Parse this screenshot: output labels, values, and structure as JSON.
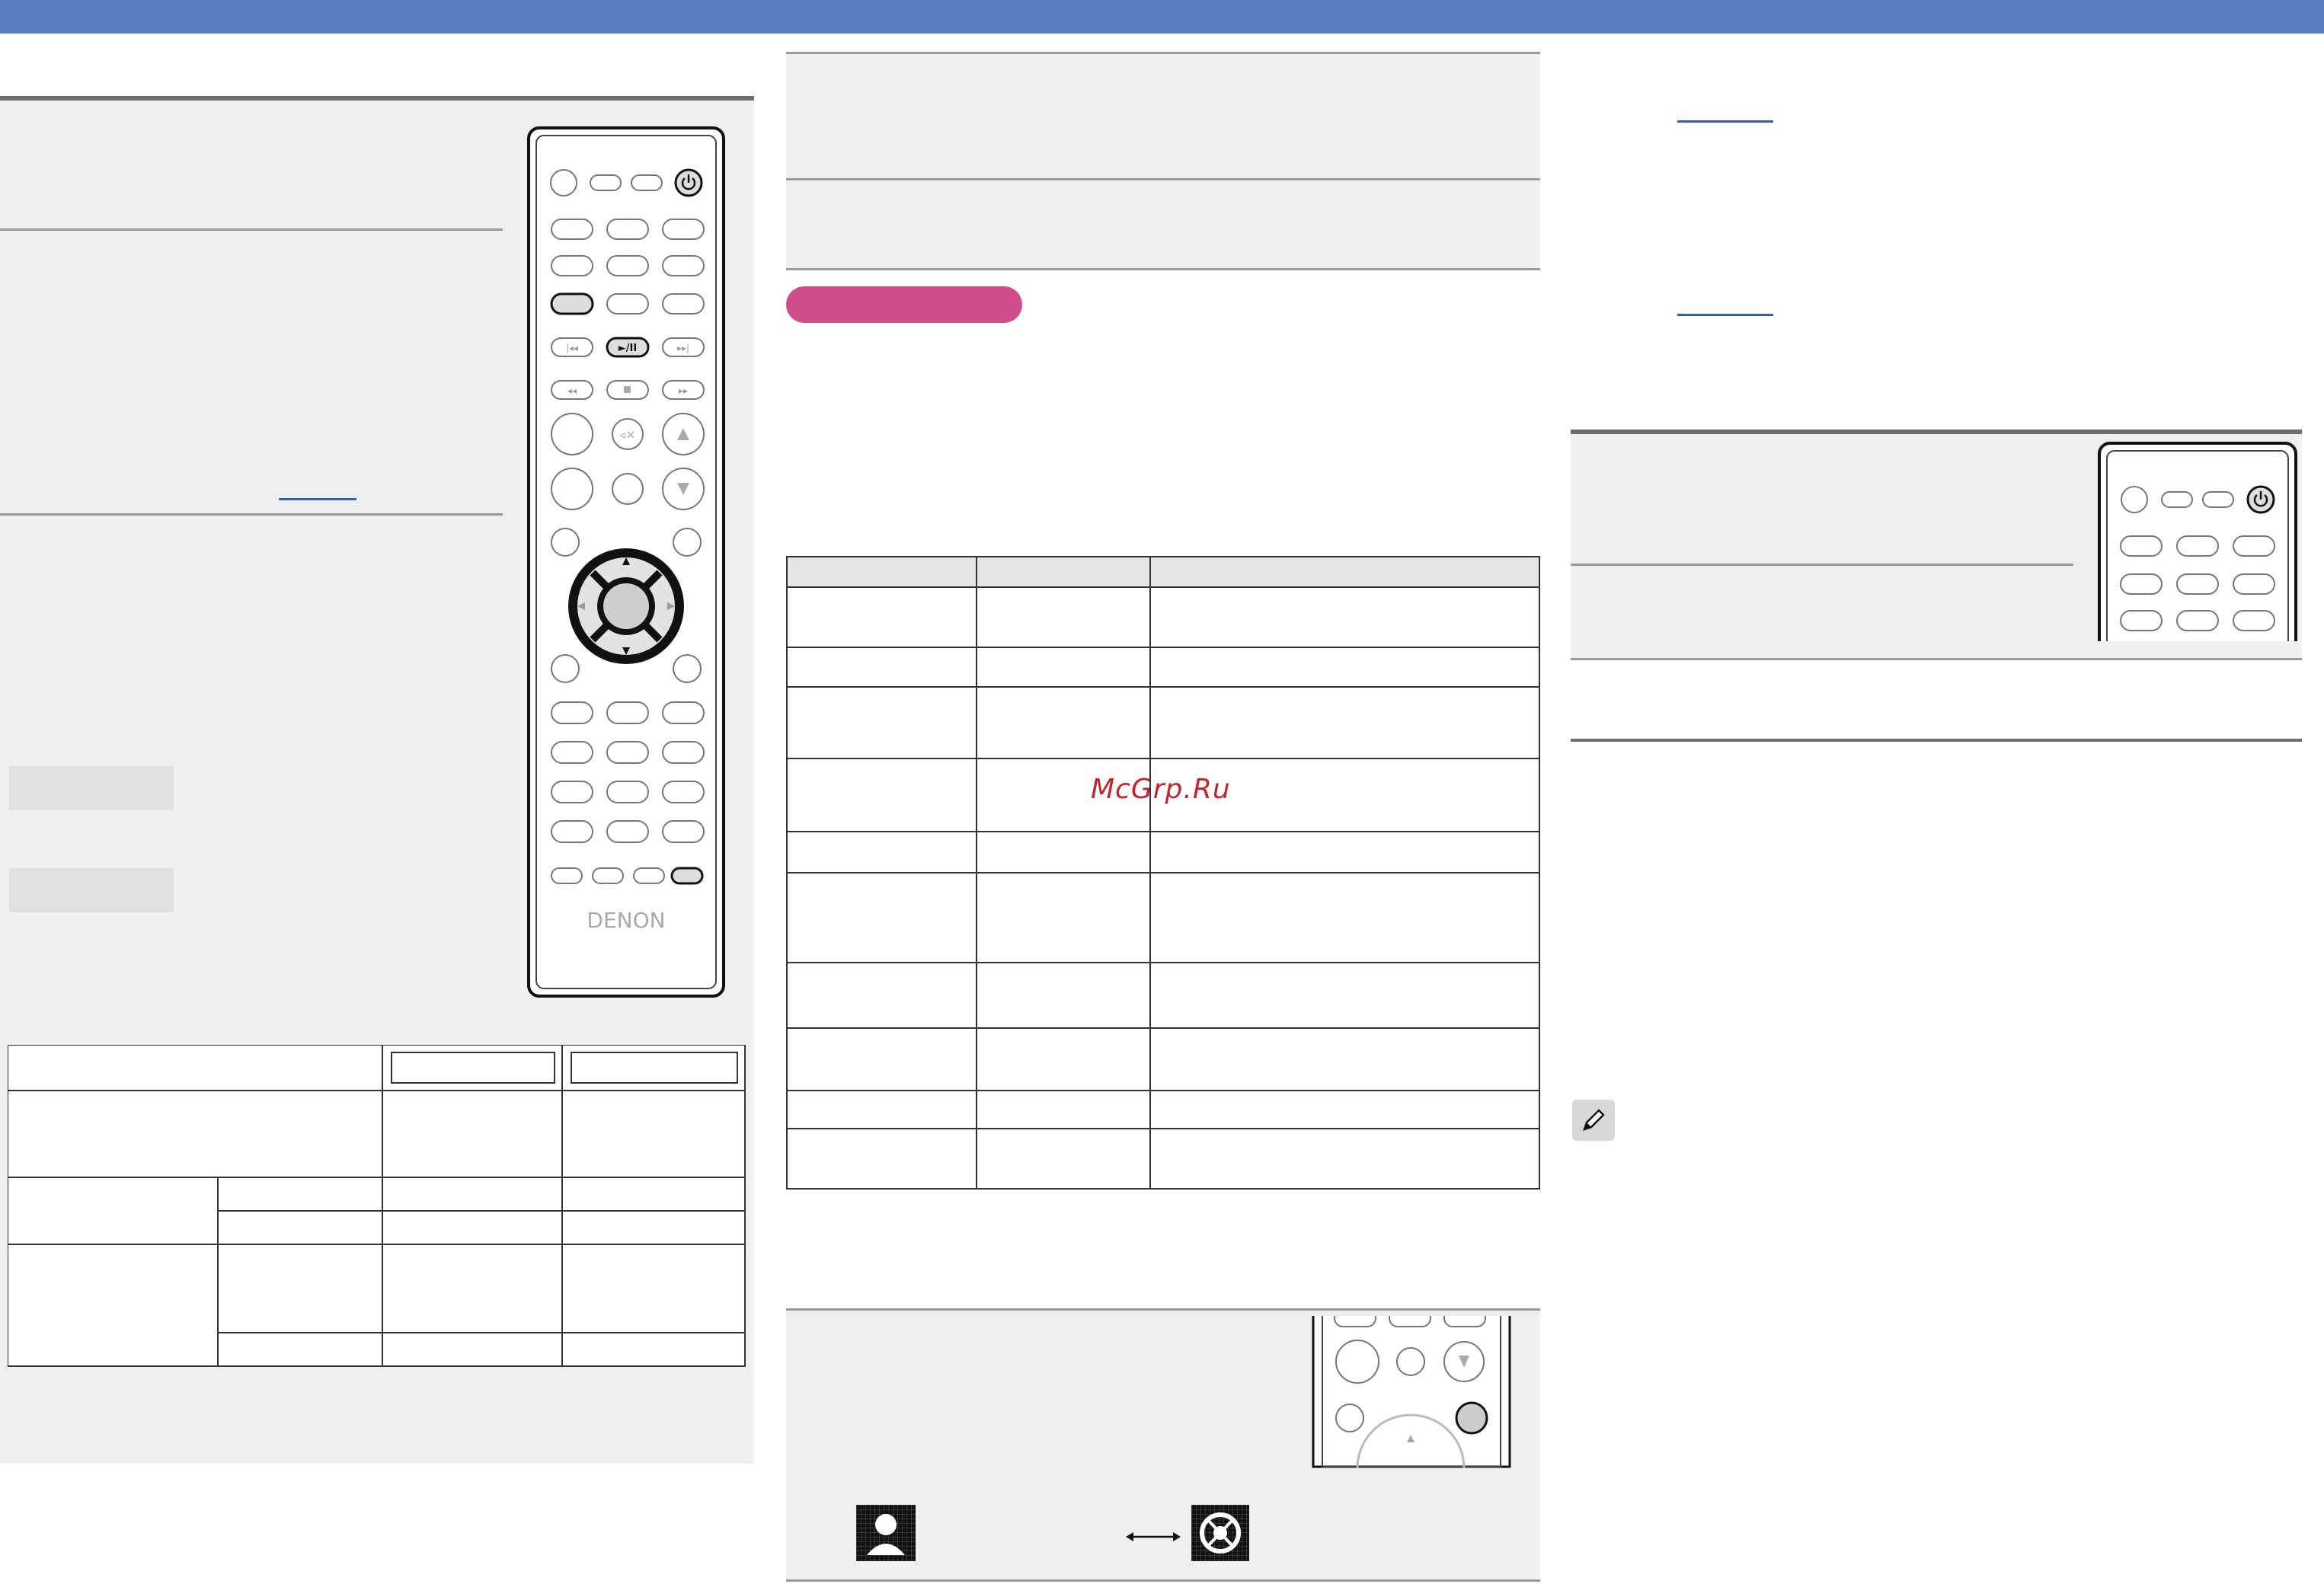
{
  "remote": {
    "brand": "DENON",
    "play_pause_label": "►/II"
  },
  "watermark": "McGrp.Ru",
  "colors": {
    "header_band": "#5b7cc0",
    "section_tag": "#d14d8a",
    "watermark": "#c0262d",
    "link_underline": "#3a5ea8"
  },
  "icons": [
    "power-icon",
    "mute-icon",
    "volume-up-icon",
    "volume-down-icon",
    "arrow-up-icon",
    "arrow-down-icon",
    "arrow-left-icon",
    "arrow-right-icon",
    "skip-back-icon",
    "skip-forward-icon",
    "rewind-icon",
    "stop-icon",
    "fast-forward-icon",
    "pencil-note-icon",
    "double-arrow-icon"
  ]
}
